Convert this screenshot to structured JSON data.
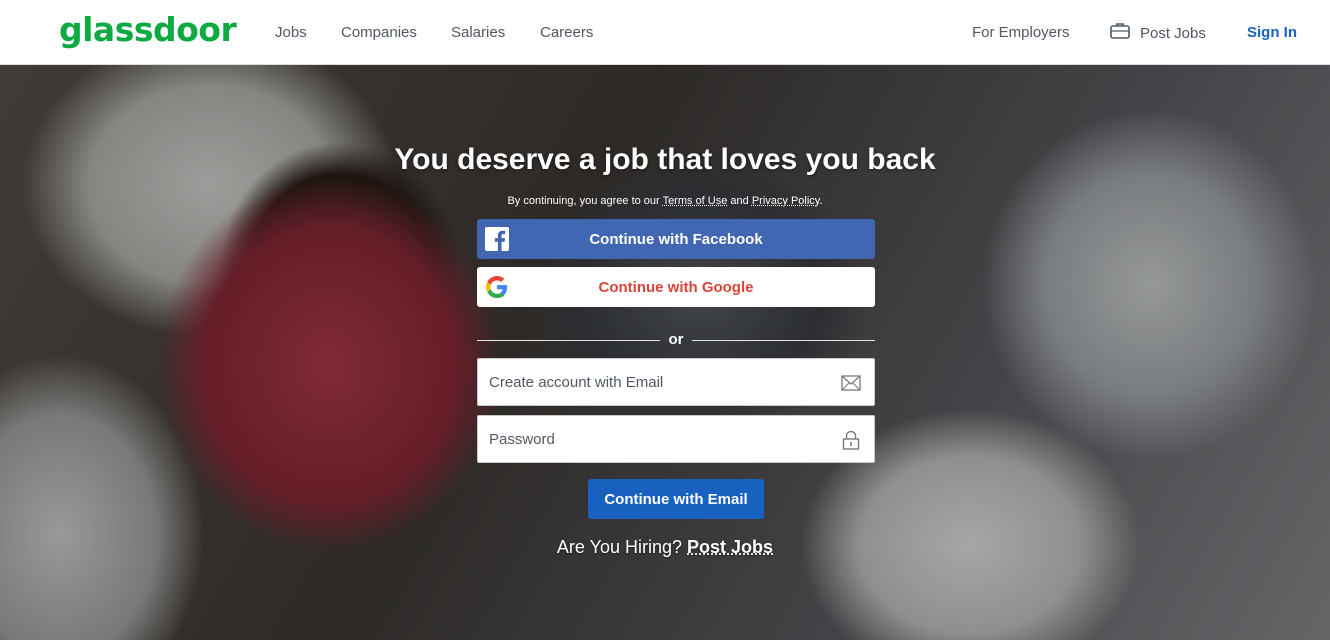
{
  "header": {
    "logo": "glassdoor",
    "nav": [
      "Jobs",
      "Companies",
      "Salaries",
      "Careers"
    ],
    "for_employers": "For Employers",
    "post_jobs": "Post Jobs",
    "sign_in": "Sign In"
  },
  "hero": {
    "headline": "You deserve a job that loves you back",
    "terms_prefix": "By continuing, you agree to our",
    "terms_link": "Terms of Use",
    "terms_and": "and",
    "privacy_link": "Privacy Policy",
    "terms_suffix": ".",
    "facebook_button": "Continue with Facebook",
    "google_button": "Continue with Google",
    "or": "or",
    "email_placeholder": "Create account with Email",
    "password_placeholder": "Password",
    "email_button": "Continue with Email",
    "hiring_text": "Are You Hiring?",
    "hiring_link": "Post Jobs"
  },
  "icons": {
    "facebook": "facebook-icon",
    "google": "google-icon",
    "email": "envelope-icon",
    "password": "lock-icon",
    "post_jobs": "briefcase-icon"
  },
  "colors": {
    "brand_green": "#0caa41",
    "facebook_blue": "#4267b2",
    "google_red": "#db4437",
    "primary_blue": "#1861bf",
    "nav_text": "#505863"
  }
}
